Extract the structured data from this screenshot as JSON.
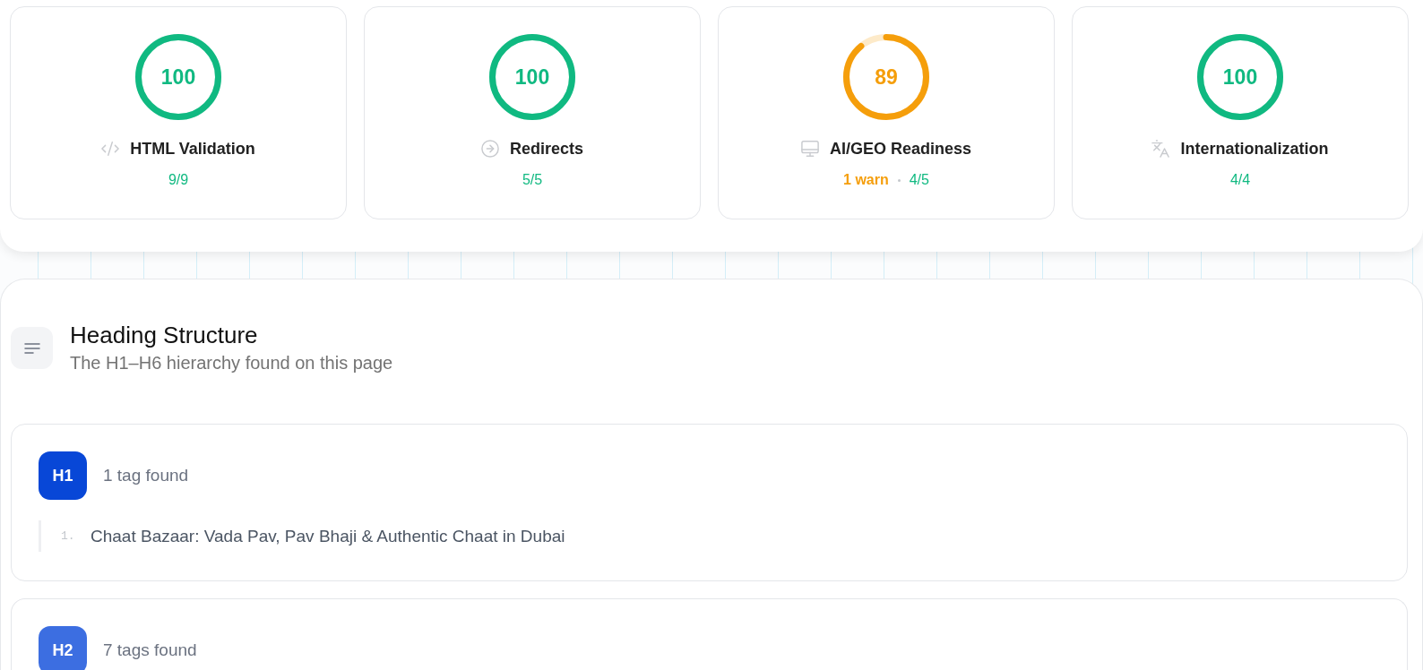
{
  "score_cards": [
    {
      "score": "100",
      "level": 1,
      "color": "#10b981",
      "title": "HTML Validation",
      "stats": [
        {
          "text": "9/9",
          "kind": "pass"
        }
      ]
    },
    {
      "score": "100",
      "level": 1,
      "color": "#10b981",
      "title": "Redirects",
      "stats": [
        {
          "text": "5/5",
          "kind": "pass"
        }
      ]
    },
    {
      "score": "89",
      "level": 0.89,
      "color": "#f59e0b",
      "title": "AI/GEO Readiness",
      "stats": [
        {
          "text": "1 warn",
          "kind": "warn"
        },
        {
          "text": "4/5",
          "kind": "pass"
        }
      ]
    },
    {
      "score": "100",
      "level": 1,
      "color": "#10b981",
      "title": "Internationalization",
      "stats": [
        {
          "text": "4/4",
          "kind": "pass"
        }
      ]
    }
  ],
  "heading_structure": {
    "title": "Heading Structure",
    "subtitle": "The H1–H6 hierarchy found on this page",
    "groups": [
      {
        "tag": "H1",
        "color": "#0847d7",
        "count": "1 tag found",
        "items": [
          {
            "number": "1.",
            "text": "Chaat Bazaar: Vada Pav, Pav Bhaji & Authentic Chaat in Dubai"
          }
        ]
      },
      {
        "tag": "H2",
        "color": "#3c6ee1",
        "count": "7 tags found"
      }
    ]
  }
}
